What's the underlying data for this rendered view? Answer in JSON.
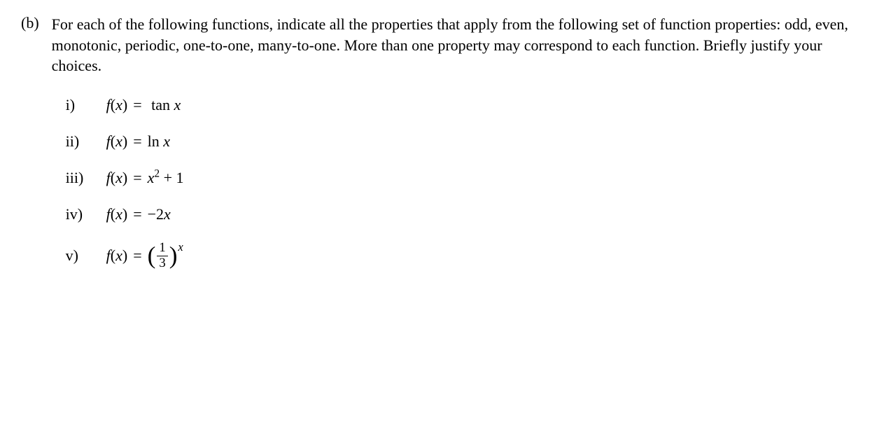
{
  "problem": {
    "label": "(b)",
    "text": "For each of the following functions, indicate all the properties that apply from the following set of function properties: odd, even, monotonic, periodic, one-to-one, many-to-one. More than one property may correspond to each function. Briefly justify your choices.",
    "items": [
      {
        "label": "i)",
        "func_lhs": "f(x)",
        "eq": "=",
        "rhs_type": "tan",
        "rhs": "tan x"
      },
      {
        "label": "ii)",
        "func_lhs": "f(x)",
        "eq": "=",
        "rhs_type": "ln",
        "rhs": "ln x"
      },
      {
        "label": "iii)",
        "func_lhs": "f(x)",
        "eq": "=",
        "rhs_type": "poly",
        "base": "x",
        "exp": "2",
        "tail": " + 1"
      },
      {
        "label": "iv)",
        "func_lhs": "f(x)",
        "eq": "=",
        "rhs_type": "linear",
        "rhs": "−2x"
      },
      {
        "label": "v)",
        "func_lhs": "f(x)",
        "eq": "=",
        "rhs_type": "frac_power",
        "num": "1",
        "den": "3",
        "power": "x"
      }
    ]
  }
}
